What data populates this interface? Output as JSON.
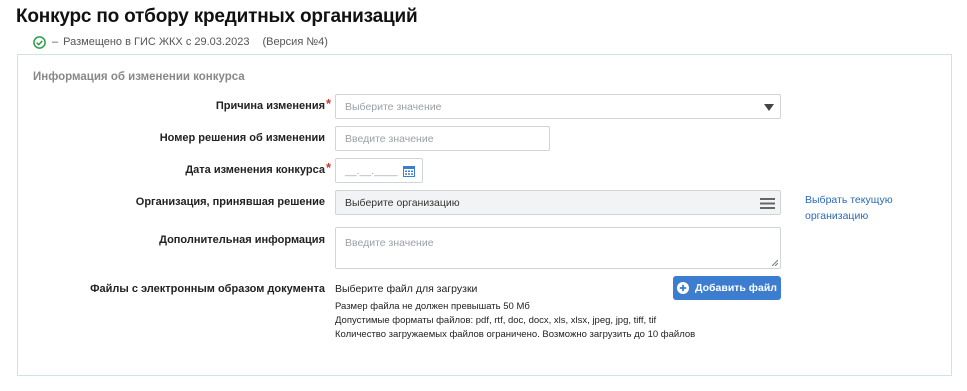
{
  "page": {
    "title": "Конкурс по отбору кредитных организаций",
    "status": {
      "separator": "–",
      "text": "Размещено в ГИС ЖКХ с 29.03.2023",
      "version": "(Версия №4)",
      "icon": "check-circle-icon",
      "icon_color": "#2e9e4a"
    }
  },
  "section": {
    "title": "Информация об изменении конкурса",
    "fields": {
      "reason": {
        "label": "Причина изменения",
        "required_mark": "*",
        "placeholder": "Выберите значение"
      },
      "decision_number": {
        "label": "Номер решения об изменении",
        "placeholder": "Введите значение"
      },
      "change_date": {
        "label": "Дата изменения конкурса",
        "required_mark": "*",
        "placeholder": "__.__.____"
      },
      "organization": {
        "label": "Организация, принявшая решение",
        "value": "Выберите организацию",
        "link": "Выбрать текущую организацию"
      },
      "additional_info": {
        "label": "Дополнительная информация",
        "placeholder": "Введите значение"
      },
      "files": {
        "label": "Файлы с электронным образом документа",
        "choose_text": "Выберите файл для загрузки",
        "button_label": "Добавить файл",
        "notes": [
          "Размер файла не должен превышать 50 Мб",
          "Допустимые форматы файлов: pdf, rtf, doc, docx, xls, xlsx, jpeg, jpg, tiff, tif",
          "Количество загружаемых файлов ограничено. Возможно загрузить до 10 файлов"
        ]
      }
    }
  },
  "colors": {
    "accent": "#3c7dd0",
    "link": "#2a6ab8",
    "required": "#c0392b",
    "panel_border": "#cfe3e6"
  }
}
